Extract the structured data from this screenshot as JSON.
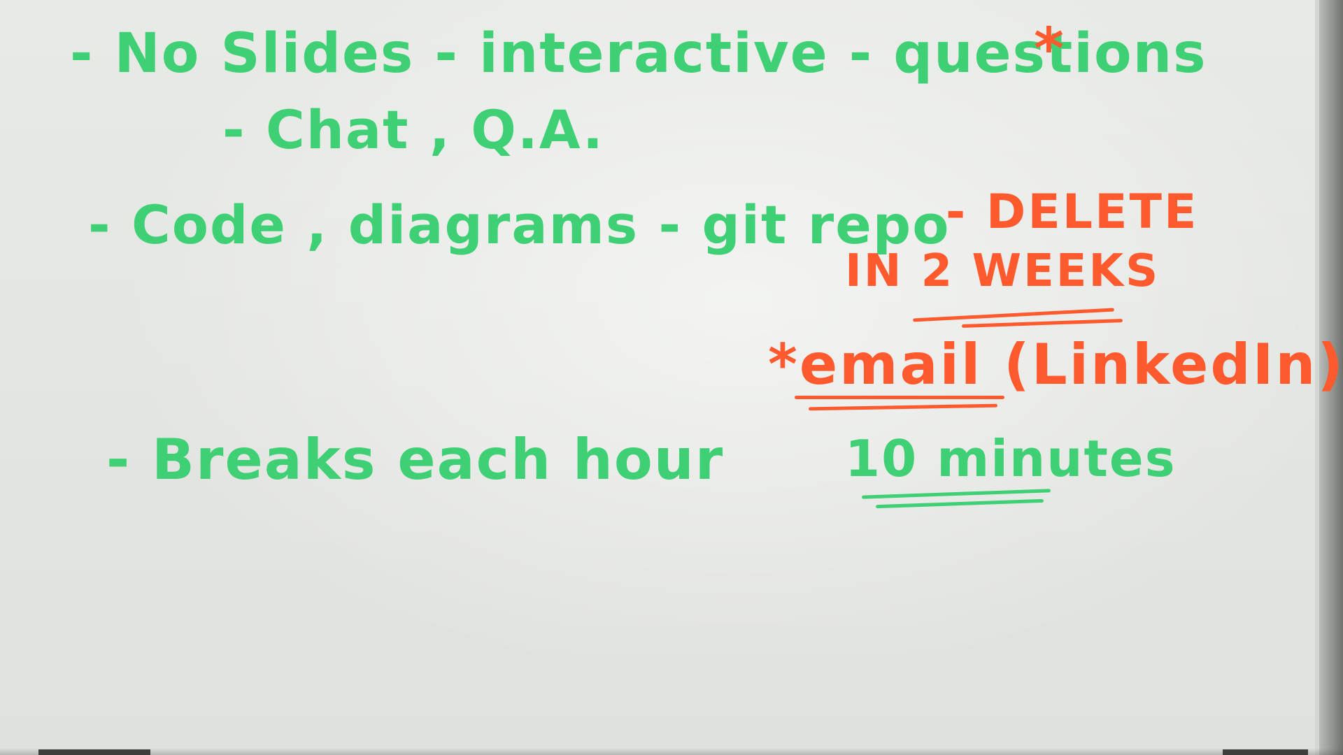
{
  "whiteboard": {
    "bullets": [
      {
        "text": "- No Slides - interactive - questions",
        "marker": "*"
      },
      {
        "text": "- Chat , Q.A."
      },
      {
        "text": "- Code , diagrams - git repo"
      },
      {
        "text": "- Breaks each hour",
        "emphasis": "10 minutes"
      }
    ],
    "notes": [
      {
        "text": "- DELETE"
      },
      {
        "text": "IN 2 WEEKS"
      },
      {
        "text": "*email (LinkedIn)"
      }
    ],
    "ink_colors": {
      "green": "#3fcf74",
      "orange": "#ff5a2e"
    }
  }
}
